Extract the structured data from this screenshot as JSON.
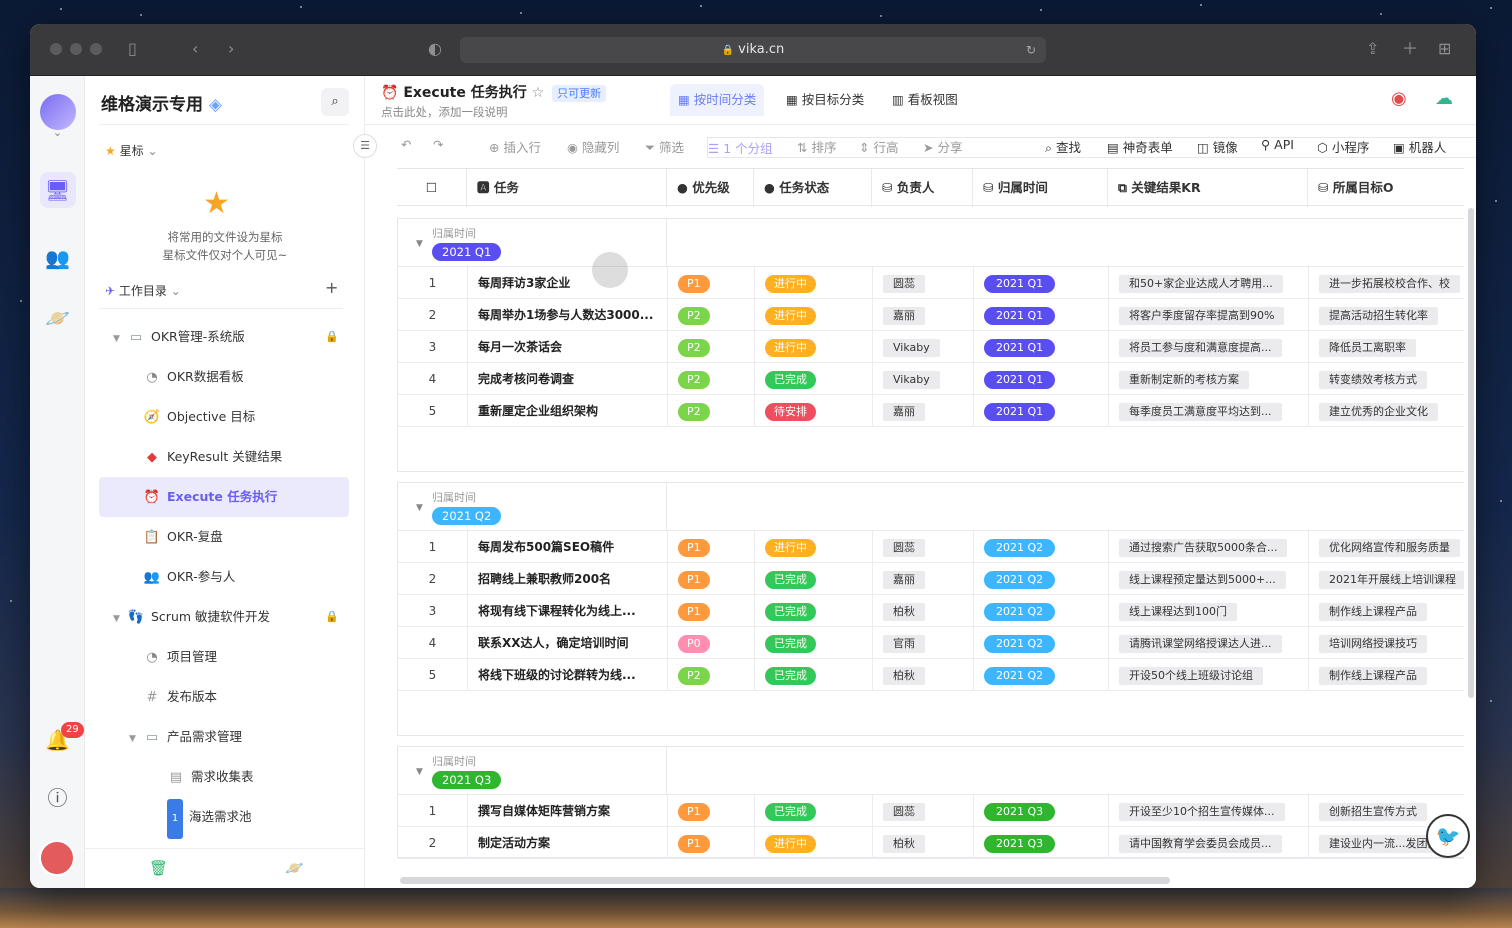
{
  "browser": {
    "url": "vika.cn"
  },
  "rail": {
    "notification_count": "29"
  },
  "sidebar": {
    "space_name": "维格演示专用",
    "starred_label": "星标",
    "starred_empty_line1": "将常用的文件设为星标",
    "starred_empty_line2": "星标文件仅对个人可见~",
    "catalog_label": "工作目录",
    "items": [
      {
        "label": "OKR管理-系统版"
      },
      {
        "label": "OKR数据看板"
      },
      {
        "label": "Objective 目标"
      },
      {
        "label": "KeyResult 关键结果"
      },
      {
        "label": "Execute 任务执行"
      },
      {
        "label": "OKR-复盘"
      },
      {
        "label": "OKR-参与人"
      },
      {
        "label": "Scrum 敏捷软件开发"
      },
      {
        "label": "项目管理"
      },
      {
        "label": "发布版本"
      },
      {
        "label": "产品需求管理"
      },
      {
        "label": "需求收集表"
      },
      {
        "label": "海选需求池"
      }
    ]
  },
  "datasheet": {
    "title": "Execute 任务执行",
    "tag": "只可更新",
    "description": "点击此处，添加一段说明"
  },
  "views": [
    "按时间分类",
    "按目标分类",
    "看板视图"
  ],
  "toolbar": {
    "insert_row": "插入行",
    "hide_cols": "隐藏列",
    "filter": "筛选",
    "group": "1 个分组",
    "sort": "排序",
    "row_height": "行高",
    "share": "分享",
    "find": "查找",
    "form": "神奇表单",
    "mirror": "镜像",
    "api": "API",
    "mini_program": "小程序",
    "robot": "机器人"
  },
  "columns": {
    "task": "任务",
    "priority": "优先级",
    "status": "任务状态",
    "owner": "负责人",
    "period": "归属时间",
    "kr": "关键结果KR",
    "objective": "所属目标O"
  },
  "colors": {
    "accent": "#6a5df3",
    "p1": "#ff9a3c",
    "p2": "#7bd44a",
    "p0": "#ff8fb0",
    "in_progress": "#ffb020",
    "done": "#34c759",
    "todo": "#f04d5e",
    "q1": "#5b4ef0",
    "q2": "#3db5ff",
    "q3": "#2fb52f"
  },
  "groups": [
    {
      "label": "归属时间",
      "value": "2021 Q1",
      "color": "#5b4ef0",
      "rows": [
        {
          "n": "1",
          "task": "每周拜访3家企业",
          "priority": "P1",
          "status": "进行中",
          "owner": "圆蕊",
          "period": "2021 Q1",
          "kr": "和50+家企业达成人才聘用...",
          "objective": "进一步拓展校校合作、校"
        },
        {
          "n": "2",
          "task": "每周举办1场参与人数达3000...",
          "priority": "P2",
          "status": "进行中",
          "owner": "嘉丽",
          "period": "2021 Q1",
          "kr": "将客户季度留存率提高到90%",
          "objective": "提高活动招生转化率"
        },
        {
          "n": "3",
          "task": "每月一次茶话会",
          "priority": "P2",
          "status": "进行中",
          "owner": "Vikaby",
          "period": "2021 Q1",
          "kr": "将员工参与度和满意度提高...",
          "objective": "降低员工离职率"
        },
        {
          "n": "4",
          "task": "完成考核问卷调查",
          "priority": "P2",
          "status": "已完成",
          "owner": "Vikaby",
          "period": "2021 Q1",
          "kr": "重新制定新的考核方案",
          "objective": "转变绩效考核方式"
        },
        {
          "n": "5",
          "task": "重新厘定企业组织架构",
          "priority": "P2",
          "status": "待安排",
          "owner": "嘉丽",
          "period": "2021 Q1",
          "kr": "每季度员工满意度平均达到...",
          "objective": "建立优秀的企业文化"
        }
      ]
    },
    {
      "label": "归属时间",
      "value": "2021 Q2",
      "color": "#3db5ff",
      "rows": [
        {
          "n": "1",
          "task": "每周发布500篇SEO稿件",
          "priority": "P1",
          "status": "进行中",
          "owner": "圆蕊",
          "period": "2021 Q2",
          "kr": "通过搜索广告获取5000条合...",
          "objective": "优化网络宣传和服务质量"
        },
        {
          "n": "2",
          "task": "招聘线上兼职教师200名",
          "priority": "P1",
          "status": "已完成",
          "owner": "嘉丽",
          "period": "2021 Q2",
          "kr": "线上课程预定量达到5000+...",
          "objective": "2021年开展线上培训课程"
        },
        {
          "n": "3",
          "task": "将现有线下课程转化为线上...",
          "priority": "P1",
          "status": "已完成",
          "owner": "柏秋",
          "period": "2021 Q2",
          "kr": "线上课程达到100门",
          "objective": "制作线上课程产品"
        },
        {
          "n": "4",
          "task": "联系XX达人，确定培训时间",
          "priority": "P0",
          "status": "已完成",
          "owner": "官雨",
          "period": "2021 Q2",
          "kr": "请腾讯课堂网络授课达人进...",
          "objective": "培训网络授课技巧"
        },
        {
          "n": "5",
          "task": "将线下班级的讨论群转为线...",
          "priority": "P2",
          "status": "已完成",
          "owner": "柏秋",
          "period": "2021 Q2",
          "kr": "开设50个线上班级讨论组",
          "objective": "制作线上课程产品"
        }
      ]
    },
    {
      "label": "归属时间",
      "value": "2021 Q3",
      "color": "#2fb52f",
      "rows": [
        {
          "n": "1",
          "task": "撰写自媒体矩阵营销方案",
          "priority": "P1",
          "status": "已完成",
          "owner": "圆蕊",
          "period": "2021 Q3",
          "kr": "开设至少10个招生宣传媒体...",
          "objective": "创新招生宣传方式"
        },
        {
          "n": "2",
          "task": "制定活动方案",
          "priority": "P1",
          "status": "进行中",
          "owner": "柏秋",
          "period": "2021 Q3",
          "kr": "请中国教育学会委员会成员...",
          "objective": "建设业内一流...发团队"
        }
      ]
    }
  ]
}
